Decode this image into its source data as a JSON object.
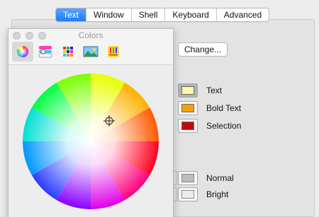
{
  "tabs": [
    {
      "label": "Text",
      "active": true
    },
    {
      "label": "Window",
      "active": false
    },
    {
      "label": "Shell",
      "active": false
    },
    {
      "label": "Keyboard",
      "active": false
    },
    {
      "label": "Advanced",
      "active": false
    }
  ],
  "change_button": "Change...",
  "color_rows": [
    {
      "label": "Text",
      "color": "#fff9a6",
      "selected": true
    },
    {
      "label": "Bold Text",
      "color": "#f5a10c",
      "selected": false
    },
    {
      "label": "Selection",
      "color": "#c4080a",
      "selected": false
    }
  ],
  "ansi_rows": [
    {
      "label": "Normal",
      "color": "#bdbdbd"
    },
    {
      "label": "Bright",
      "color": "#ececec"
    }
  ],
  "colors_panel": {
    "title": "Colors",
    "modes": [
      {
        "icon": "color-wheel-icon",
        "active": true
      },
      {
        "icon": "color-sliders-icon",
        "active": false
      },
      {
        "icon": "color-palettes-icon",
        "active": false
      },
      {
        "icon": "image-palettes-icon",
        "active": false
      },
      {
        "icon": "crayons-icon",
        "active": false
      }
    ]
  }
}
